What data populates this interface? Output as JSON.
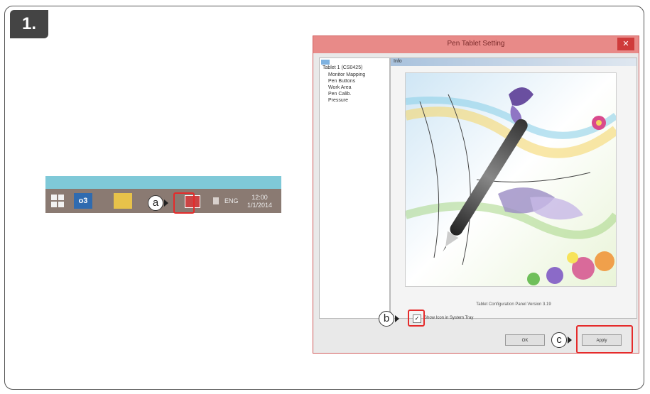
{
  "step": {
    "number": "1."
  },
  "taskbar": {
    "outlook_label": "o3",
    "language": "ENG",
    "clock_time": "12:00",
    "clock_date": "1/1/2014"
  },
  "callouts": {
    "a": "a",
    "b": "b",
    "c": "c"
  },
  "dialog": {
    "title": "Pen Tablet Setting",
    "close_symbol": "✕",
    "nav": {
      "root": "Tablet 1 (CS0425)",
      "items": [
        "Monitor Mapping",
        "Pen Buttons",
        "Work Area",
        "Pen Calib.",
        "Pressure"
      ]
    },
    "panel_title": "Info",
    "version_text": "Tablet Configuration Panel Version 3.19",
    "checkbox_label": "Show Icon in System Tray",
    "checkbox_mark": "✓",
    "ok_label": "OK",
    "apply_label": "Apply"
  },
  "colors": {
    "highlight": "#e52b2b",
    "titlebar": "#e88a88",
    "taskbar": "#8a7a72"
  }
}
